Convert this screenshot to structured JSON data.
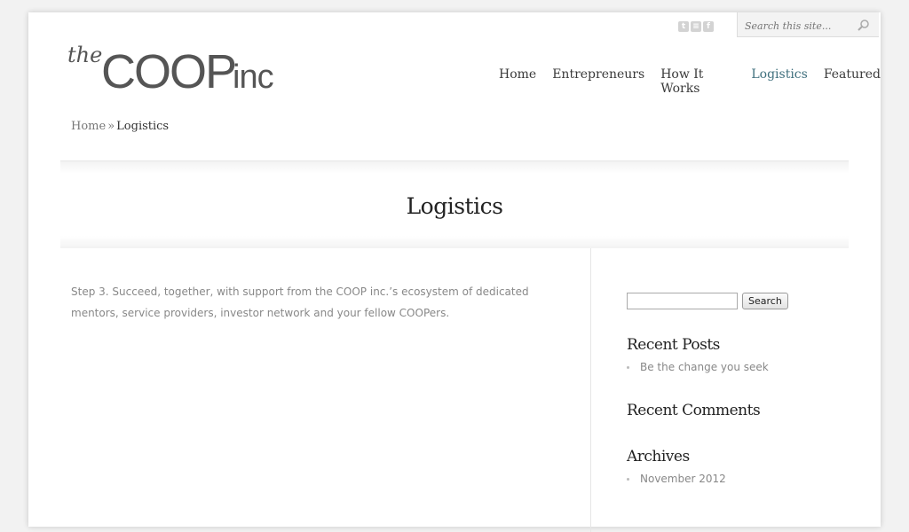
{
  "social": [
    {
      "name": "twitter-icon",
      "glyph": "t"
    },
    {
      "name": "rss-icon",
      "glyph": "≡"
    },
    {
      "name": "facebook-icon",
      "glyph": "f"
    }
  ],
  "search_top": {
    "placeholder": "Search this site..."
  },
  "logo": {
    "the": "the",
    "coop": "COOP",
    "inc": "inc"
  },
  "nav": [
    "Home",
    "Entrepreneurs",
    "How It Works",
    "Logistics",
    "Featured"
  ],
  "nav_active": "Logistics",
  "breadcrumb": {
    "home": "Home",
    "sep": "»",
    "current": "Logistics"
  },
  "page_title": "Logistics",
  "content": "Step 3. Succeed, together, with support from the COOP inc.’s ecosystem of dedicated mentors, service providers, investor network and your fellow COOPers.",
  "sidebar": {
    "search_button": "Search",
    "recent_posts_title": "Recent Posts",
    "recent_posts": [
      "Be the change you seek"
    ],
    "recent_comments_title": "Recent Comments",
    "archives_title": "Archives",
    "archives": [
      "November 2012"
    ]
  }
}
